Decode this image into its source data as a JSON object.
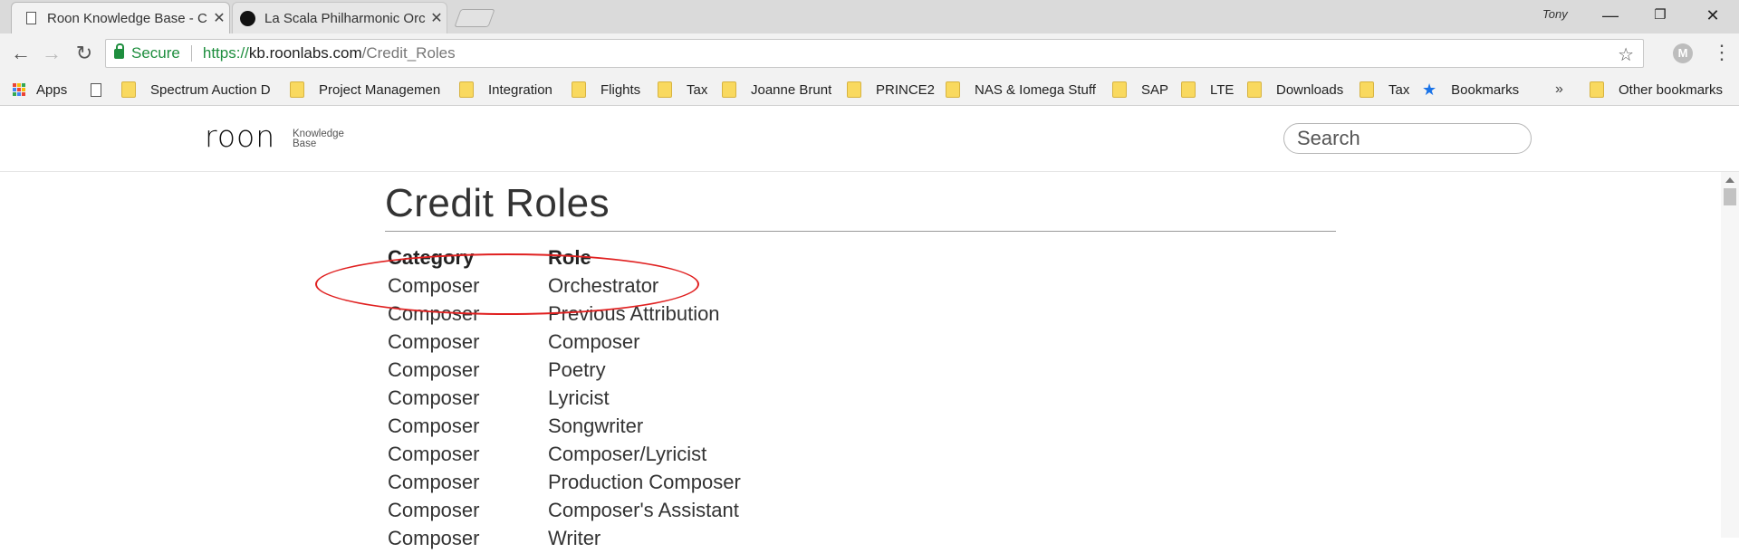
{
  "browser": {
    "tabs": [
      {
        "title": "Roon Knowledge Base - C",
        "active": true,
        "icon": "page-icon"
      },
      {
        "title": "La Scala Philharmonic Orc",
        "active": false,
        "icon": "roon-logo-icon"
      }
    ],
    "user": "Tony",
    "address": {
      "secure_label": "Secure",
      "scheme": "https://",
      "host": "kb.roonlabs.com",
      "path": "/Credit_Roles"
    },
    "extension_letter": "M",
    "bookmarks": [
      {
        "label": "Apps",
        "icon": "apps-grid-icon"
      },
      {
        "label": "",
        "icon": "page-icon"
      },
      {
        "label": "Spectrum Auction D",
        "icon": "folder-icon"
      },
      {
        "label": "Project Managemen",
        "icon": "folder-icon"
      },
      {
        "label": "Integration",
        "icon": "folder-icon"
      },
      {
        "label": "Flights",
        "icon": "folder-icon"
      },
      {
        "label": "Tax",
        "icon": "folder-icon"
      },
      {
        "label": "Joanne Brunt",
        "icon": "folder-icon"
      },
      {
        "label": "PRINCE2",
        "icon": "folder-icon"
      },
      {
        "label": "NAS & Iomega Stuff",
        "icon": "folder-icon"
      },
      {
        "label": "SAP",
        "icon": "folder-icon"
      },
      {
        "label": "LTE",
        "icon": "folder-icon"
      },
      {
        "label": "Downloads",
        "icon": "folder-icon"
      },
      {
        "label": "Tax",
        "icon": "folder-icon"
      },
      {
        "label": "Bookmarks",
        "icon": "star-icon"
      }
    ],
    "overflow_label": "»",
    "other_bookmarks": "Other bookmarks"
  },
  "site": {
    "logo": "roon",
    "logo_sub_line1": "Knowledge",
    "logo_sub_line2": "Base",
    "search_placeholder": "Search"
  },
  "page": {
    "title": "Credit Roles",
    "columns": [
      "Category",
      "Role"
    ],
    "rows": [
      [
        "Composer",
        "Orchestrator"
      ],
      [
        "Composer",
        "Previous Attribution"
      ],
      [
        "Composer",
        "Composer"
      ],
      [
        "Composer",
        "Poetry"
      ],
      [
        "Composer",
        "Lyricist"
      ],
      [
        "Composer",
        "Songwriter"
      ],
      [
        "Composer",
        "Composer/Lyricist"
      ],
      [
        "Composer",
        "Production Composer"
      ],
      [
        "Composer",
        "Composer's Assistant"
      ],
      [
        "Composer",
        "Writer"
      ]
    ]
  },
  "colors": {
    "secure_green": "#1e8e3e",
    "annotation_red": "#e02020",
    "folder_yellow": "#f9d95f"
  }
}
